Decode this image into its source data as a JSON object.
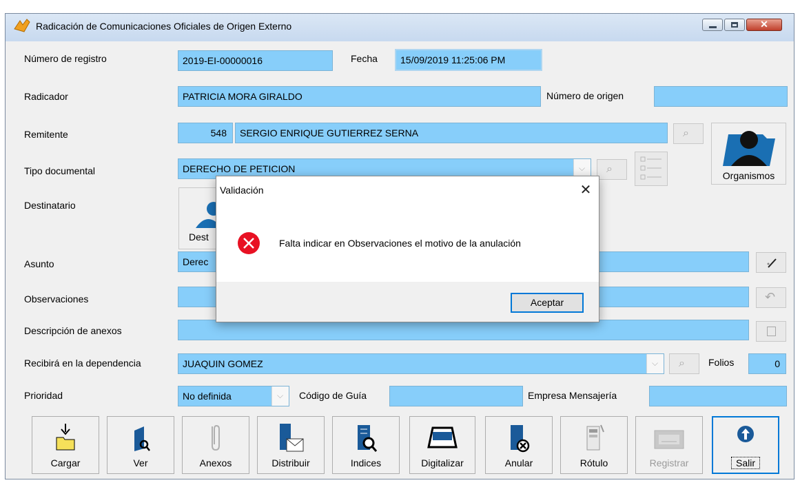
{
  "window": {
    "title": "Radicación de Comunicaciones Oficiales de Origen Externo"
  },
  "labels": {
    "numero_registro": "Número de registro",
    "fecha": "Fecha",
    "radicador": "Radicador",
    "numero_origen": "Número de origen",
    "remitente": "Remitente",
    "tipo_documental": "Tipo documental",
    "destinatario": "Destinatario",
    "asunto": "Asunto",
    "observaciones": "Observaciones",
    "descripcion_anexos": "Descripción de anexos",
    "recibira": "Recibirá en la dependencia",
    "folios": "Folios",
    "prioridad": "Prioridad",
    "codigo_guia": "Código de Guía",
    "empresa": "Empresa Mensajería"
  },
  "values": {
    "numero_registro": "2019-EI-00000016",
    "fecha": "15/09/2019 11:25:06 PM",
    "radicador": "PATRICIA MORA GIRALDO",
    "numero_origen": "",
    "remitente_codigo": "548",
    "remitente_nombre": "SERGIO ENRIQUE GUTIERREZ SERNA",
    "tipo_documental": "DERECHO DE PETICION",
    "asunto": "Derec",
    "observaciones": "",
    "descripcion_anexos": "",
    "recibira": "JUAQUIN GOMEZ",
    "folios": "0",
    "prioridad": "No definida",
    "codigo_guia": "",
    "empresa": ""
  },
  "buttons": {
    "organismos": "Organismos",
    "destinatario_partial": "Dest"
  },
  "toolbar": [
    {
      "label": "Cargar",
      "icon": "folder-load-icon"
    },
    {
      "label": "Ver",
      "icon": "view-document-icon"
    },
    {
      "label": "Anexos",
      "icon": "paperclip-icon"
    },
    {
      "label": "Distribuir",
      "icon": "distribute-icon"
    },
    {
      "label": "Indices",
      "icon": "index-search-icon"
    },
    {
      "label": "Digitalizar",
      "icon": "scanner-icon"
    },
    {
      "label": "Anular",
      "icon": "cancel-document-icon"
    },
    {
      "label": "Rótulo",
      "icon": "label-icon"
    },
    {
      "label": "Registrar",
      "icon": "register-icon"
    },
    {
      "label": "Salir",
      "icon": "exit-icon"
    }
  ],
  "dialog": {
    "title": "Validación",
    "message": "Falta indicar en Observaciones el motivo de la anulación",
    "ok": "Aceptar"
  }
}
